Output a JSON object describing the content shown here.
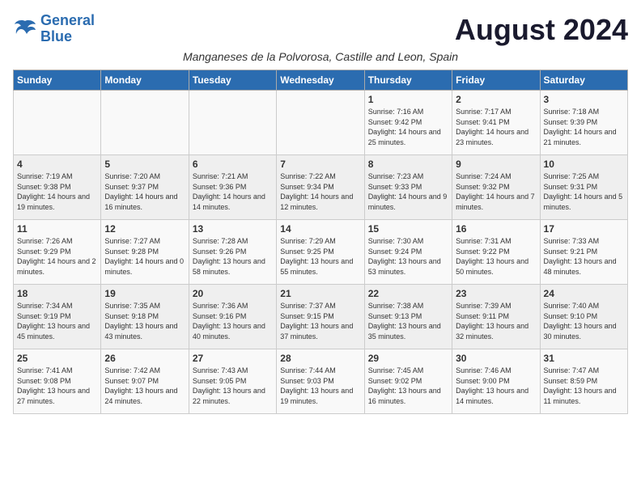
{
  "header": {
    "logo_line1": "General",
    "logo_line2": "Blue",
    "month_year": "August 2024",
    "subtitle": "Manganeses de la Polvorosa, Castille and Leon, Spain"
  },
  "weekdays": [
    "Sunday",
    "Monday",
    "Tuesday",
    "Wednesday",
    "Thursday",
    "Friday",
    "Saturday"
  ],
  "weeks": [
    [
      {
        "day": "",
        "info": ""
      },
      {
        "day": "",
        "info": ""
      },
      {
        "day": "",
        "info": ""
      },
      {
        "day": "",
        "info": ""
      },
      {
        "day": "1",
        "info": "Sunrise: 7:16 AM\nSunset: 9:42 PM\nDaylight: 14 hours\nand 25 minutes."
      },
      {
        "day": "2",
        "info": "Sunrise: 7:17 AM\nSunset: 9:41 PM\nDaylight: 14 hours\nand 23 minutes."
      },
      {
        "day": "3",
        "info": "Sunrise: 7:18 AM\nSunset: 9:39 PM\nDaylight: 14 hours\nand 21 minutes."
      }
    ],
    [
      {
        "day": "4",
        "info": "Sunrise: 7:19 AM\nSunset: 9:38 PM\nDaylight: 14 hours\nand 19 minutes."
      },
      {
        "day": "5",
        "info": "Sunrise: 7:20 AM\nSunset: 9:37 PM\nDaylight: 14 hours\nand 16 minutes."
      },
      {
        "day": "6",
        "info": "Sunrise: 7:21 AM\nSunset: 9:36 PM\nDaylight: 14 hours\nand 14 minutes."
      },
      {
        "day": "7",
        "info": "Sunrise: 7:22 AM\nSunset: 9:34 PM\nDaylight: 14 hours\nand 12 minutes."
      },
      {
        "day": "8",
        "info": "Sunrise: 7:23 AM\nSunset: 9:33 PM\nDaylight: 14 hours\nand 9 minutes."
      },
      {
        "day": "9",
        "info": "Sunrise: 7:24 AM\nSunset: 9:32 PM\nDaylight: 14 hours\nand 7 minutes."
      },
      {
        "day": "10",
        "info": "Sunrise: 7:25 AM\nSunset: 9:31 PM\nDaylight: 14 hours\nand 5 minutes."
      }
    ],
    [
      {
        "day": "11",
        "info": "Sunrise: 7:26 AM\nSunset: 9:29 PM\nDaylight: 14 hours\nand 2 minutes."
      },
      {
        "day": "12",
        "info": "Sunrise: 7:27 AM\nSunset: 9:28 PM\nDaylight: 14 hours\nand 0 minutes."
      },
      {
        "day": "13",
        "info": "Sunrise: 7:28 AM\nSunset: 9:26 PM\nDaylight: 13 hours\nand 58 minutes."
      },
      {
        "day": "14",
        "info": "Sunrise: 7:29 AM\nSunset: 9:25 PM\nDaylight: 13 hours\nand 55 minutes."
      },
      {
        "day": "15",
        "info": "Sunrise: 7:30 AM\nSunset: 9:24 PM\nDaylight: 13 hours\nand 53 minutes."
      },
      {
        "day": "16",
        "info": "Sunrise: 7:31 AM\nSunset: 9:22 PM\nDaylight: 13 hours\nand 50 minutes."
      },
      {
        "day": "17",
        "info": "Sunrise: 7:33 AM\nSunset: 9:21 PM\nDaylight: 13 hours\nand 48 minutes."
      }
    ],
    [
      {
        "day": "18",
        "info": "Sunrise: 7:34 AM\nSunset: 9:19 PM\nDaylight: 13 hours\nand 45 minutes."
      },
      {
        "day": "19",
        "info": "Sunrise: 7:35 AM\nSunset: 9:18 PM\nDaylight: 13 hours\nand 43 minutes."
      },
      {
        "day": "20",
        "info": "Sunrise: 7:36 AM\nSunset: 9:16 PM\nDaylight: 13 hours\nand 40 minutes."
      },
      {
        "day": "21",
        "info": "Sunrise: 7:37 AM\nSunset: 9:15 PM\nDaylight: 13 hours\nand 37 minutes."
      },
      {
        "day": "22",
        "info": "Sunrise: 7:38 AM\nSunset: 9:13 PM\nDaylight: 13 hours\nand 35 minutes."
      },
      {
        "day": "23",
        "info": "Sunrise: 7:39 AM\nSunset: 9:11 PM\nDaylight: 13 hours\nand 32 minutes."
      },
      {
        "day": "24",
        "info": "Sunrise: 7:40 AM\nSunset: 9:10 PM\nDaylight: 13 hours\nand 30 minutes."
      }
    ],
    [
      {
        "day": "25",
        "info": "Sunrise: 7:41 AM\nSunset: 9:08 PM\nDaylight: 13 hours\nand 27 minutes."
      },
      {
        "day": "26",
        "info": "Sunrise: 7:42 AM\nSunset: 9:07 PM\nDaylight: 13 hours\nand 24 minutes."
      },
      {
        "day": "27",
        "info": "Sunrise: 7:43 AM\nSunset: 9:05 PM\nDaylight: 13 hours\nand 22 minutes."
      },
      {
        "day": "28",
        "info": "Sunrise: 7:44 AM\nSunset: 9:03 PM\nDaylight: 13 hours\nand 19 minutes."
      },
      {
        "day": "29",
        "info": "Sunrise: 7:45 AM\nSunset: 9:02 PM\nDaylight: 13 hours\nand 16 minutes."
      },
      {
        "day": "30",
        "info": "Sunrise: 7:46 AM\nSunset: 9:00 PM\nDaylight: 13 hours\nand 14 minutes."
      },
      {
        "day": "31",
        "info": "Sunrise: 7:47 AM\nSunset: 8:59 PM\nDaylight: 13 hours\nand 11 minutes."
      }
    ]
  ]
}
